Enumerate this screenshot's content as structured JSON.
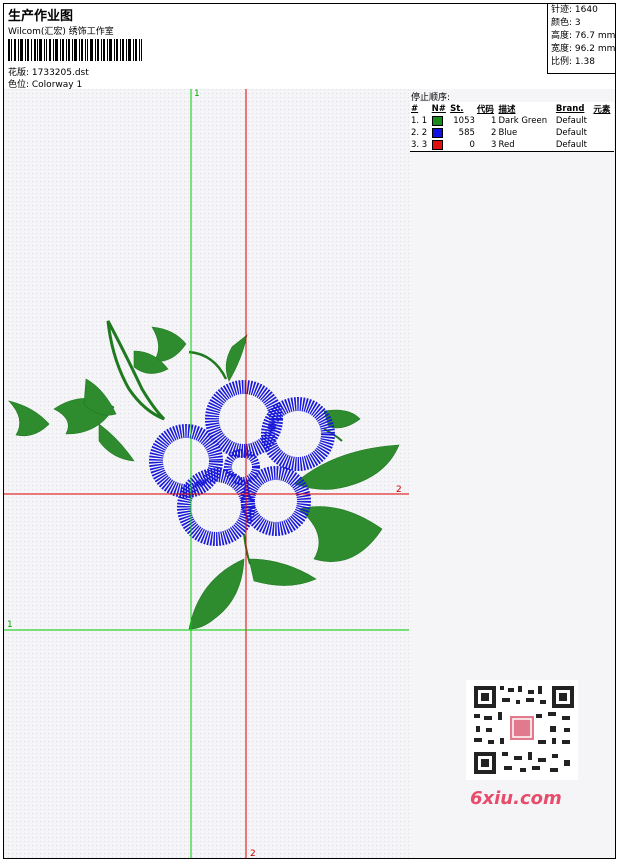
{
  "header": {
    "title": "生产作业图",
    "software": "Wilcom(汇宏) 绣饰工作室",
    "design": "花版:  1733205.dst",
    "colorway": "色位:  Colorway 1"
  },
  "stats": [
    {
      "label": "针迹:",
      "value": "1640"
    },
    {
      "label": "颜色:",
      "value": "3"
    },
    {
      "label": "高度:",
      "value": "76.7 mm"
    },
    {
      "label": "宽度:",
      "value": "96.2 mm"
    },
    {
      "label": "比例:",
      "value": "1.38"
    }
  ],
  "panel": {
    "title": "停止顺序:",
    "columns": [
      "#",
      "N#",
      "St.",
      "代码",
      "描述",
      "Brand",
      "元素"
    ],
    "rows": [
      {
        "idx": "1. 1",
        "stitches": "1053",
        "code": "1",
        "desc": "Dark Green",
        "brand": "Default",
        "color": "#1a8a1a"
      },
      {
        "idx": "2. 2",
        "stitches": "585",
        "code": "2",
        "desc": "Blue",
        "brand": "Default",
        "color": "#1010e0"
      },
      {
        "idx": "3. 3",
        "stitches": "0",
        "code": "3",
        "desc": "Red",
        "brand": "Default",
        "color": "#e01010"
      }
    ]
  },
  "guides": {
    "label_v1": "1",
    "label_h1": "1",
    "label_v2": "2",
    "label_h2": "2",
    "green": "#00cc00",
    "red": "#dd0000"
  },
  "watermark": "6xiu.com",
  "colors": {
    "leaf": "#2e8b2e",
    "flower": "#1818d8"
  }
}
